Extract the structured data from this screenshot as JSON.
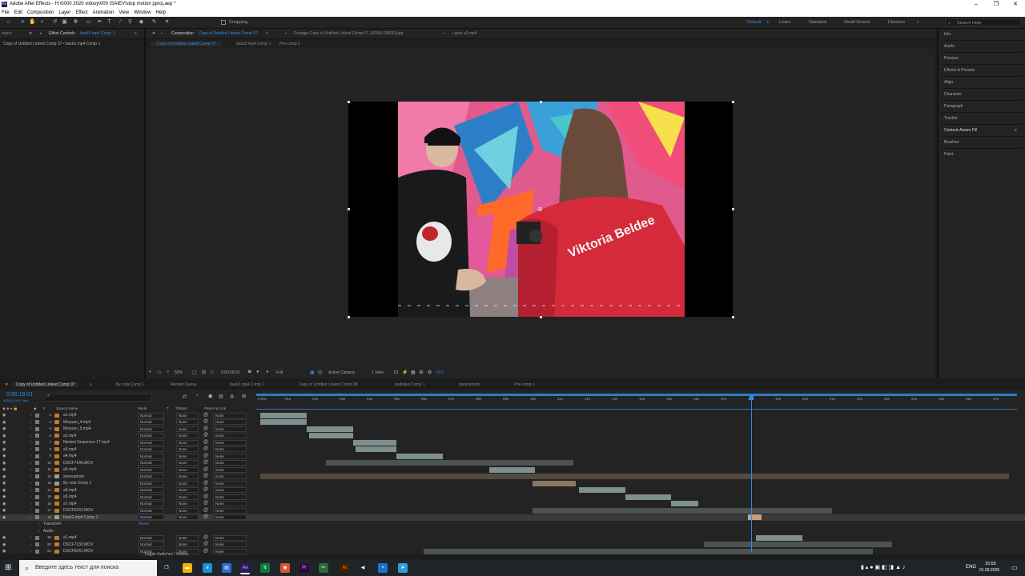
{
  "window": {
    "title": "Adobe After Effects - H:\\0000 2020 vidosy\\000 ISAIEV\\stop motion pproj.aep *",
    "minimize": "–",
    "maximize": "❐",
    "close": "✕"
  },
  "menu": [
    "File",
    "Edit",
    "Composition",
    "Layer",
    "Effect",
    "Animation",
    "View",
    "Window",
    "Help"
  ],
  "toolbar": {
    "snapping_label": "Snapping",
    "workspaces": [
      {
        "label": "Default",
        "active": true
      },
      {
        "label": "Learn",
        "active": false
      },
      {
        "label": "Standard",
        "active": false
      },
      {
        "label": "Small Screen",
        "active": false
      },
      {
        "label": "Libraries",
        "active": false
      }
    ],
    "search_placeholder": "Search Help"
  },
  "left_panel": {
    "tab_project": "roject",
    "tab_effect_controls_prefix": "Effect Controls",
    "tab_effect_controls_layer": "back2.mp4 Comp 1",
    "breadcrumb": "Copy of Untitled Linked Comp 07 • back2.mp4 Comp 1"
  },
  "comp_panel": {
    "tab_composition_prefix": "Composition",
    "tab_composition_name": "Copy of Untitled Linked Comp 07",
    "tab_footage": "Footage  Copy of Untitled Linked Comp 07_[00000-00690].jpg",
    "tab_layer": "Layer  a3.mp4",
    "subtabs": [
      "Copy of Untitled Linked Comp 07",
      "back2.mp4 Comp 1",
      "Pre-comp 1"
    ]
  },
  "viewer_controls": {
    "zoom": "50%",
    "timecode": "0:00:18:01",
    "resolution": "Full",
    "camera": "Active Camera",
    "views": "1 View",
    "exposure": "+0.0"
  },
  "right_panel": {
    "items": [
      "Info",
      "Audio",
      "Preview",
      "Effects & Presets",
      "Align",
      "Character",
      "Paragraph",
      "Tracker",
      "Content-Aware Fill",
      "Brushes",
      "Paint"
    ]
  },
  "timeline": {
    "tabs": [
      {
        "label": "Copy of Untitled Linked Comp 07",
        "active": true
      },
      {
        "label": "lily cola Comp 1",
        "active": false
      },
      {
        "label": "Render Queue",
        "active": false
      },
      {
        "label": "back2.mp4 Comp 1",
        "active": false
      },
      {
        "label": "Copy of Untitled Linked Comp 08",
        "active": false
      },
      {
        "label": "podlojka Comp 1",
        "active": false
      },
      {
        "label": "stereophoto",
        "active": false
      },
      {
        "label": "Pre-comp 1",
        "active": false
      }
    ],
    "current_time": "0:00:18:01",
    "frame_info": "00541 (29.97 fps)",
    "columns": {
      "source_name": "Source Name",
      "mode": "Mode",
      "trkmat": "TrkMat",
      "parent": "Parent & Link"
    },
    "ruler": [
      "0:00s",
      "01s",
      "02s",
      "03s",
      "04s",
      "05s",
      "06s",
      "07s",
      "08s",
      "09s",
      "10s",
      "11s",
      "12s",
      "13s",
      "14s",
      "15s",
      "16s",
      "17s",
      "18s",
      "19s",
      "20s",
      "21s",
      "22s",
      "23s",
      "24s",
      "25s",
      "26s",
      "27s"
    ],
    "layers": [
      {
        "num": "3",
        "name": "a1.mp4",
        "type": "video",
        "mode": "Normal",
        "trkmat": "None",
        "parent": "None",
        "bar_start_s": 0,
        "bar_end_s": 1.7
      },
      {
        "num": "4",
        "name": "Moyuan_4.mp4",
        "type": "video",
        "mode": "Normal",
        "trkmat": "None",
        "parent": "None",
        "bar_start_s": 0,
        "bar_end_s": 1.7
      },
      {
        "num": "5",
        "name": "Moyuan_5.mp4",
        "type": "video",
        "mode": "Normal",
        "trkmat": "None",
        "parent": "None",
        "bar_start_s": 1.7,
        "bar_end_s": 3.4
      },
      {
        "num": "6",
        "name": "a2.mp4",
        "type": "video",
        "mode": "Normal",
        "trkmat": "None",
        "parent": "None",
        "bar_start_s": 1.8,
        "bar_end_s": 3.4
      },
      {
        "num": "7",
        "name": "Nested Sequence 17.mp4",
        "type": "video",
        "mode": "Normal",
        "trkmat": "None",
        "parent": "None",
        "bar_start_s": 3.4,
        "bar_end_s": 5.0
      },
      {
        "num": "8",
        "name": "a3.mp4",
        "type": "video",
        "mode": "Normal",
        "trkmat": "None",
        "parent": "None",
        "bar_start_s": 3.5,
        "bar_end_s": 5.0
      },
      {
        "num": "9",
        "name": "a4.mp4",
        "type": "video",
        "mode": "Normal",
        "trkmat": "None",
        "parent": "None",
        "bar_start_s": 5.0,
        "bar_end_s": 6.7
      },
      {
        "num": "10",
        "name": "DSCF7146.MOV",
        "type": "video",
        "mode": "Normal",
        "trkmat": "None",
        "parent": "None",
        "bar_start_s": 2.4,
        "bar_end_s": 11.5
      },
      {
        "num": "11",
        "name": "a5.mp4",
        "type": "video",
        "mode": "Normal",
        "trkmat": "None",
        "parent": "None",
        "bar_start_s": 8.4,
        "bar_end_s": 10.1
      },
      {
        "num": "12",
        "name": "stereophoto",
        "type": "comp",
        "mode": "Normal",
        "trkmat": "None",
        "parent": "None",
        "bar_start_s": 0,
        "bar_end_s": 27.5
      },
      {
        "num": "13",
        "name": "lily cola Comp 1",
        "type": "comp",
        "mode": "Normal",
        "trkmat": "None",
        "parent": "None",
        "bar_start_s": 10.0,
        "bar_end_s": 11.6
      },
      {
        "num": "14",
        "name": "a6.mp4",
        "type": "video",
        "mode": "Normal",
        "trkmat": "None",
        "parent": "None",
        "bar_start_s": 11.7,
        "bar_end_s": 13.4
      },
      {
        "num": "15",
        "name": "a5.mp4",
        "type": "video",
        "mode": "Normal",
        "trkmat": "None",
        "parent": "None",
        "bar_start_s": 13.4,
        "bar_end_s": 15.1
      },
      {
        "num": "16",
        "name": "a7.mp4",
        "type": "video",
        "mode": "Normal",
        "trkmat": "None",
        "parent": "None",
        "bar_start_s": 15.1,
        "bar_end_s": 16.1
      },
      {
        "num": "17",
        "name": "DSCF6243.MOV",
        "type": "video",
        "mode": "Normal",
        "trkmat": "None",
        "parent": "None",
        "bar_start_s": 10.0,
        "bar_end_s": 21.0
      },
      {
        "num": "18",
        "name": "back2.mp4 Comp 1",
        "type": "comp",
        "mode": "Normal",
        "trkmat": "None",
        "parent": "None",
        "selected": true,
        "bar_start_s": 17.9,
        "bar_end_s": 18.4
      },
      {
        "num": "19",
        "name": "a1.mp4",
        "type": "video",
        "mode": "Normal",
        "trkmat": "None",
        "parent": "None",
        "bar_start_s": 18.2,
        "bar_end_s": 19.9
      },
      {
        "num": "20",
        "name": "DSCF7130.MOV",
        "type": "video",
        "mode": "Normal",
        "trkmat": "None",
        "parent": "None",
        "bar_start_s": 16.3,
        "bar_end_s": 23.2
      },
      {
        "num": "21",
        "name": "DSCF6241.MOV",
        "type": "video",
        "mode": "Normal",
        "trkmat": "None",
        "parent": "None",
        "bar_start_s": 6.0,
        "bar_end_s": 22.5
      }
    ],
    "sub_props": {
      "transform": "Transform",
      "reset": "Reset",
      "audio": "Audio"
    },
    "footer": "Toggle Switches / Modes"
  },
  "taskbar": {
    "search_placeholder": "Введите здесь текст для поиска",
    "lang": "ENG",
    "time": "15:55",
    "date": "01.09.2020"
  },
  "colors": {
    "accent": "#2d8ceb",
    "panel_bg": "#232323",
    "video_bar": "#7e8f8f",
    "comp_bar": "#8b7763",
    "selected_bar": "#c2a07a"
  }
}
